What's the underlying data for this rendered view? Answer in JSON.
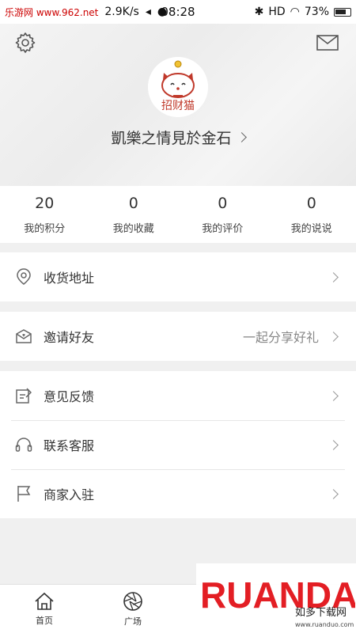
{
  "status_bar": {
    "watermark": "乐游网 www.962.net",
    "speed": "2.9K/s",
    "time": "08:28",
    "network": "HD",
    "battery": "73%"
  },
  "header": {
    "settings_icon": "gear-icon",
    "message_icon": "mail-icon",
    "avatar_text": "招财猫",
    "username": "凱樂之情見於金石"
  },
  "stats": [
    {
      "value": "20",
      "label": "我的积分"
    },
    {
      "value": "0",
      "label": "我的收藏"
    },
    {
      "value": "0",
      "label": "我的评价"
    },
    {
      "value": "0",
      "label": "我的说说"
    }
  ],
  "menu": {
    "address": {
      "label": "收货地址",
      "icon": "location-pin-icon"
    },
    "invite": {
      "label": "邀请好友",
      "hint": "一起分享好礼",
      "icon": "invite-envelope-icon"
    },
    "feedback": {
      "label": "意见反馈",
      "icon": "feedback-edit-icon"
    },
    "service": {
      "label": "联系客服",
      "icon": "headset-icon"
    },
    "merchant": {
      "label": "商家入驻",
      "icon": "flag-icon"
    }
  },
  "tabbar": [
    {
      "label": "首页",
      "icon": "home-icon"
    },
    {
      "label": "广场",
      "icon": "aperture-icon"
    }
  ],
  "brand_watermark": {
    "logo": "RUANDADO",
    "text": "如多下载网",
    "url": "www.ruanduo.com"
  },
  "colors": {
    "background": "#f0f0f0",
    "header_bg": "#efefef",
    "text": "#333333",
    "hint": "#888888",
    "watermark_red": "#e31e24",
    "watermark_green": "#3aa935"
  }
}
